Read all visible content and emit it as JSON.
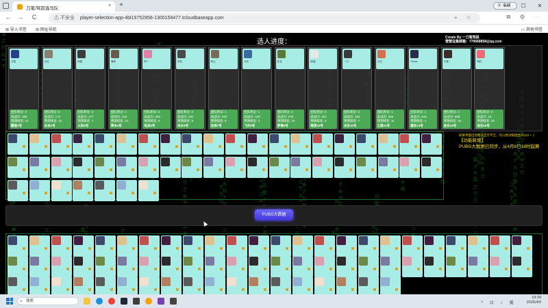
{
  "browser": {
    "tab_title": "刀笔/驾驭选马队",
    "tab_close": "×",
    "newtab": "+",
    "pill": "Ⓐ 来网 ·",
    "win_min": "—",
    "win_max": "☐",
    "win_close": "✕",
    "nav_back": "←",
    "nav_forward": "→",
    "nav_reload": "C",
    "insecure": "⚠ 不安全",
    "url": "player-selection-app-4bl19752858-1300158477.tcloudbaseapp.com",
    "addr_icons": "⌖ ☆",
    "tool_icons": "⧉ ⚙ ⋯",
    "bookmark_import": "⊞ 导入书签",
    "bookmark_nav": "⊞ 网址导航",
    "bookmark_other": "▭ 其他书签"
  },
  "page": {
    "title": "选人进度：",
    "credit_line1": "Create By 一刀笔驾民",
    "credit_line2": "营营征集邮箱：779668858@qq.com",
    "notice_small": "如果界面出现错误显示不全，可以尝试缩放显示(ctrl + -)",
    "notice_line1": "【功能新增】",
    "notice_line2": "PUBG大数据已同步，从4月8日18时起算",
    "pubg_button": "PUBG大数据"
  },
  "teams": [
    {
      "leader": "刀笔",
      "score": "团队积分: 0",
      "power": "总战力: 195",
      "rank": "预测排名: 12",
      "name": "霸道1号",
      "color": "#2a3f8a"
    },
    {
      "leader": "小红",
      "score": "团队积分: 0",
      "power": "总战力: 174",
      "rank": "预测排名: 13",
      "name": "水龙2号",
      "color": "#8a7f6f"
    },
    {
      "leader": "阿昌",
      "score": "团队积分: 0",
      "power": "总战力: 377",
      "rank": "预测排名: 7",
      "name": "火凤3号",
      "color": "#3b3b3b"
    },
    {
      "leader": "海哥",
      "score": "团队积分: 1",
      "power": "总战力: 160",
      "rank": "预测排名: 14",
      "name": "草木4号",
      "color": "#6b5a4a"
    },
    {
      "leader": "阿一",
      "score": "团队积分: 0",
      "power": "总战力: 306",
      "rank": "预测排名: 6",
      "name": "电龙5号",
      "color": "#e07fa8"
    },
    {
      "leader": "苏苏",
      "score": "团队积分: 0",
      "power": "总战力: 281",
      "rank": "预测排名: 8",
      "name": "冰水6号",
      "color": "#4a4a4a"
    },
    {
      "leader": "阿九",
      "score": "团队积分: 1",
      "power": "总战力: 310",
      "rank": "预测排名: 5",
      "name": "沧海7号",
      "color": "#7a6a5a"
    },
    {
      "leader": "大乐",
      "score": "团队积分: 1",
      "power": "总战力: 438",
      "rank": "预测排名: 3",
      "name": "飞天8号",
      "color": "#3a6b9e"
    },
    {
      "leader": "无名",
      "score": "团队积分: 0",
      "power": "总战力: 276",
      "rank": "预测排名: 10",
      "name": "梦境9号",
      "color": "#5a7a3a"
    },
    {
      "leader": "阿涵",
      "score": "团队积分: 0",
      "power": "总战力: 427",
      "rank": "预测排名: 4",
      "name": "暗夜10号",
      "color": "#e8e8e8"
    },
    {
      "leader": "一刀",
      "score": "团队积分: 0",
      "power": "总战力: 284",
      "rank": "预测排名: 7",
      "name": "光东11号",
      "color": "#3a3a3a"
    },
    {
      "leader": "小白",
      "score": "团队积分: 1",
      "power": "总战力: 256",
      "rank": "预测排名: 11",
      "name": "土黑12号",
      "color": "#d47050"
    },
    {
      "leader": "Tricker",
      "score": "团队积分: 1",
      "power": "总战力: 644",
      "rank": "预测排名: 1",
      "name": "毒东13号",
      "color": "#2a2a4a"
    },
    {
      "leader": "小猫",
      "score": "团队积分: 2",
      "power": "总战力: 588",
      "rank": "预测排名: 15",
      "name": "金东15号",
      "color": "#3b2b2b"
    },
    {
      "leader": "阿红",
      "score": "团队积分: 0",
      "power": "总战力: 15",
      "rank": "预测排名: 15",
      "name": "流东16号",
      "color": "#f06a7a"
    }
  ],
  "taskbar": {
    "search": "搜索",
    "tray_icons": "^ ⊡ ♪ 英",
    "time": "19:39",
    "date": "2026/4/9"
  }
}
